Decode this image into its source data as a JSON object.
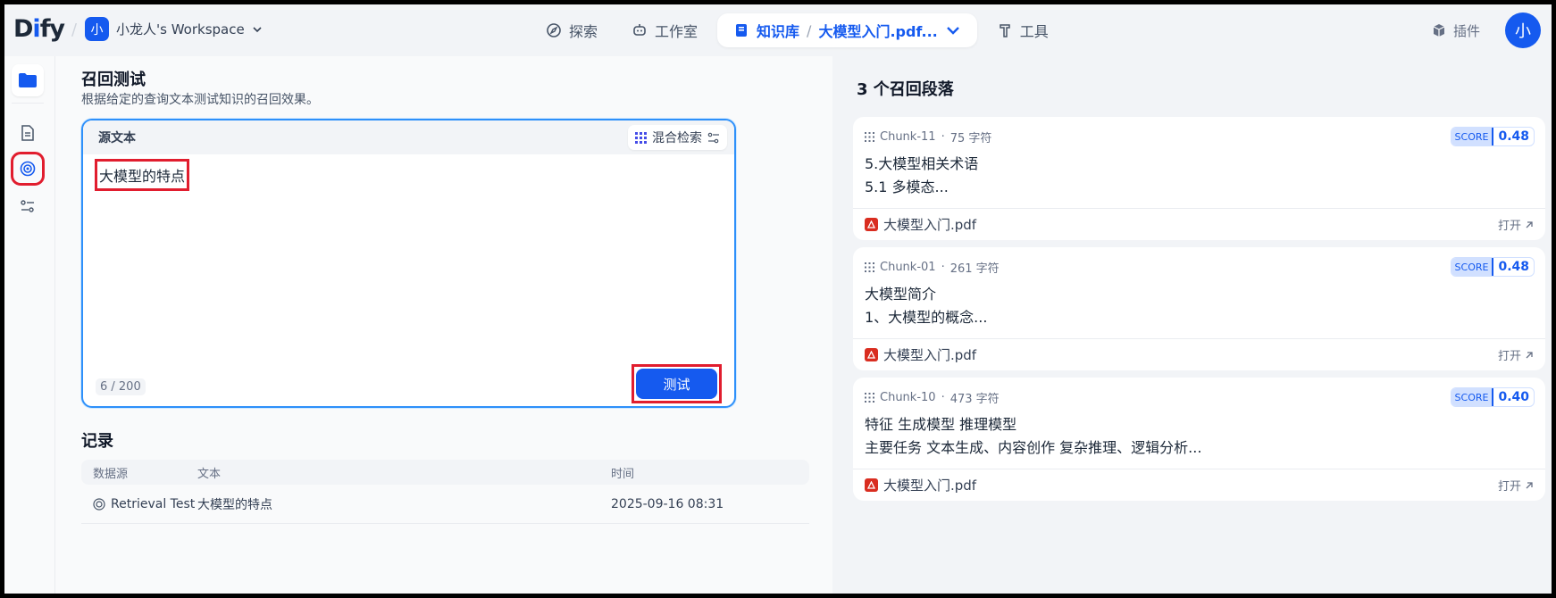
{
  "logo": {
    "text_d": "D",
    "text_i": "i",
    "text_fy": "fy"
  },
  "workspace": {
    "avatar": "小",
    "name": "小龙人's Workspace"
  },
  "nav": {
    "explore": "探索",
    "studio": "工作室",
    "knowledge": "知识库",
    "doc": "大模型入门.pdf...",
    "tools": "工具"
  },
  "plugins": "插件",
  "user_avatar": "小",
  "main": {
    "title": "召回测试",
    "subtitle": "根据给定的查询文本测试知识的召回效果。",
    "source_label": "源文本",
    "mode": "混合检索",
    "query": "大模型的特点",
    "counter": "6 / 200",
    "test_button": "测试"
  },
  "records": {
    "title": "记录",
    "headers": [
      "数据源",
      "文本",
      "时间"
    ],
    "rows": [
      {
        "source": "Retrieval Test",
        "text": "大模型的特点",
        "time": "2025-09-16 08:31"
      }
    ]
  },
  "results": {
    "title": "3 个召回段落",
    "score_label": "SCORE",
    "open_label": "打开",
    "chunks": [
      {
        "id": "Chunk-11",
        "chars": "75 字符",
        "score": "0.48",
        "line1": "5.大模型相关术语",
        "line2": "5.1 多模态...",
        "file": "大模型入门.pdf"
      },
      {
        "id": "Chunk-01",
        "chars": "261 字符",
        "score": "0.48",
        "line1": "大模型简介",
        "line2": "1、大模型的概念...",
        "file": "大模型入门.pdf"
      },
      {
        "id": "Chunk-10",
        "chars": "473 字符",
        "score": "0.40",
        "line1": "特征 生成模型 推理模型",
        "line2": "主要任务 文本生成、内容创作 复杂推理、逻辑分析...",
        "file": "大模型入门.pdf"
      }
    ]
  },
  "colors": {
    "accent": "#155aef",
    "highlight": "#e11d2e",
    "border_active": "#2e90fa"
  }
}
